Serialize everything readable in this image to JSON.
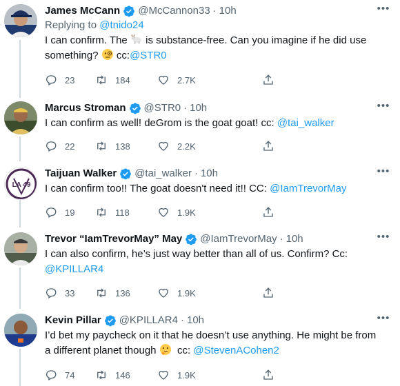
{
  "colors": {
    "text": "#0f1419",
    "secondary": "#536471",
    "link": "#1d9bf0",
    "thread_line": "#cfd9de",
    "verified": "#1d9bf0"
  },
  "tweets": [
    {
      "name": "James McCann",
      "handle": "@McCannon33",
      "time": "10h",
      "replying_prefix": "Replying to",
      "replying_to": "@tnido24",
      "line1_a": "I can confirm. The",
      "emoji1": "goat-emoji",
      "line1_b": "is substance-free. Can you imagine if he did use",
      "line2_a": "something?",
      "emoji2": "face-with-monocle-emoji",
      "line2_b": "cc:",
      "line2_link": "@STR0",
      "replies": "23",
      "retweets": "184",
      "likes": "2.7K"
    },
    {
      "name": "Marcus Stroman",
      "handle": "@STR0",
      "time": "10h",
      "text": "I can confirm as well! deGrom is the goat goat! cc:",
      "link": "@tai_walker",
      "replies": "22",
      "retweets": "138",
      "likes": "2.2K"
    },
    {
      "name": "Taijuan Walker",
      "handle": "@tai_walker",
      "time": "10h",
      "text": "I can confirm too!! The goat doesn't need it!! CC:",
      "link": "@IamTrevorMay",
      "avatar_text": "LA 49",
      "replies": "19",
      "retweets": "118",
      "likes": "1.9K"
    },
    {
      "name": "Trevor “IamTrevorMay” May",
      "handle": "@IamTrevorMay",
      "time": "10h",
      "line1": "I can also confirm, he’s just way better than all of us. Confirm? Cc:",
      "line2_link": "@KPILLAR4",
      "replies": "33",
      "retweets": "136",
      "likes": "1.9K"
    },
    {
      "name": "Kevin Pillar",
      "handle": "@KPILLAR4",
      "time": "10h",
      "line1": "I’d bet my paycheck on it that he doesn’t use anything. He might be from",
      "line2_a": "a different planet though",
      "emoji": "thinking-face-emoji",
      "line2_b": "cc:",
      "line2_link": "@StevenACohen2",
      "replies": "74",
      "retweets": "146",
      "likes": "1.9K"
    }
  ],
  "more_glyph": "•••",
  "separator": "·"
}
